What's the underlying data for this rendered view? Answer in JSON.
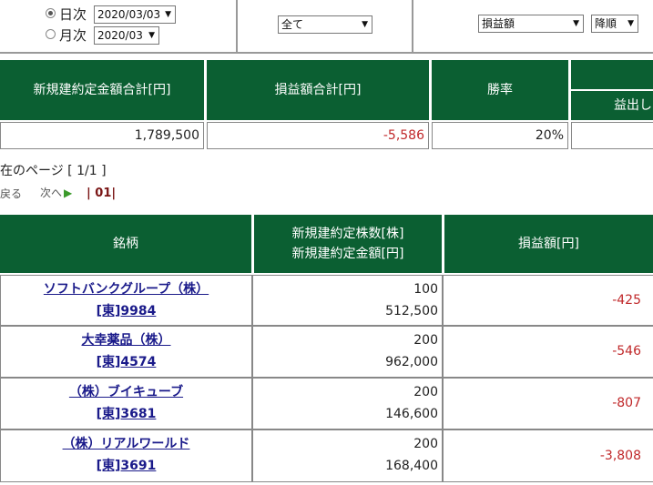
{
  "filters": {
    "daily_label": "日次",
    "daily_value": "2020/03/03",
    "monthly_label": "月次",
    "monthly_value": "2020/03",
    "category_value": "全て",
    "sort_field_value": "損益額",
    "sort_order_value": "降順"
  },
  "summary": {
    "headers": [
      "新規建約定金額合計[円]",
      "損益額合計[円]",
      "勝率",
      "益出し"
    ],
    "values": [
      "1,789,500",
      "-5,586",
      "20%"
    ]
  },
  "pagination": {
    "page_label": "在のページ [ 1/1 ]",
    "prev": "戻る",
    "next": "次へ",
    "page_link": "| 01|"
  },
  "detail": {
    "headers": {
      "name": "銘柄",
      "qty_line1": "新規建約定株数[株]",
      "qty_line2": "新規建約定金額[円]",
      "pl": "損益額[円]"
    },
    "rows": [
      {
        "name": "ソフトバンクグループ（株）",
        "code": "[東]9984",
        "shares": "100",
        "amount": "512,500",
        "pl": "-425"
      },
      {
        "name": "大幸薬品（株）",
        "code": "[東]4574",
        "shares": "200",
        "amount": "962,000",
        "pl": "-546"
      },
      {
        "name": "（株）ブイキューブ",
        "code": "[東]3681",
        "shares": "200",
        "amount": "146,600",
        "pl": "-807"
      },
      {
        "name": "（株）リアルワールド",
        "code": "[東]3691",
        "shares": "200",
        "amount": "168,400",
        "pl": "-3,808"
      }
    ]
  }
}
